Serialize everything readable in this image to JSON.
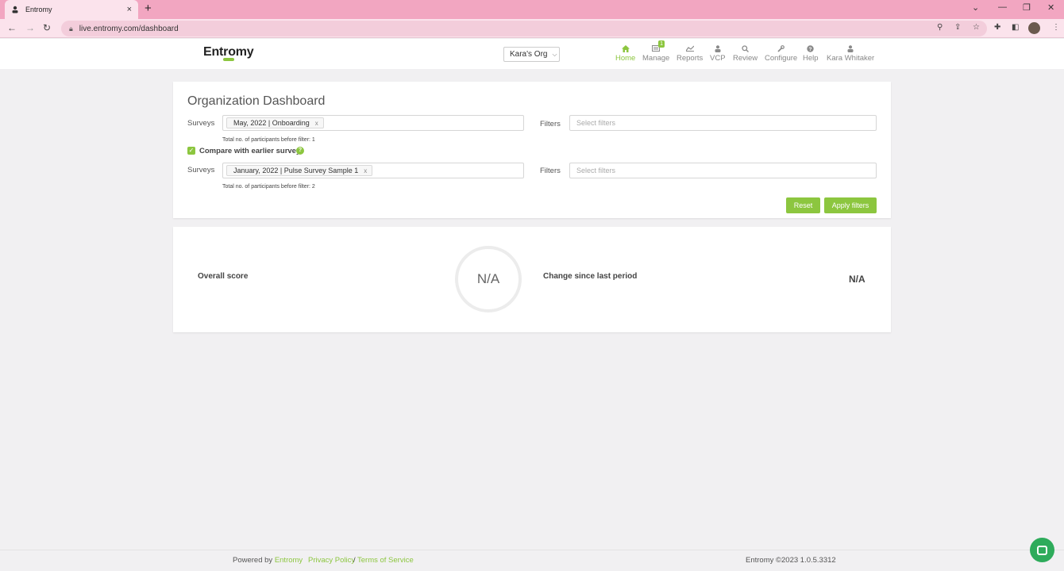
{
  "browser": {
    "tab_title": "Entromy",
    "tab_close": "×",
    "new_tab": "+",
    "url": "live.entromy.com/dashboard"
  },
  "header": {
    "logo": "Entromy",
    "org_select": "Kara's Org",
    "nav": [
      {
        "label": "Home",
        "icon": "home-icon",
        "active": true
      },
      {
        "label": "Manage",
        "icon": "manage-icon",
        "badge": "1"
      },
      {
        "label": "Reports",
        "icon": "chart-icon"
      },
      {
        "label": "VCP",
        "icon": "user-icon"
      },
      {
        "label": "Review",
        "icon": "search-icon"
      },
      {
        "label": "Configure",
        "icon": "wrench-icon"
      },
      {
        "label": "Help",
        "icon": "question-icon"
      },
      {
        "label": "Kara Whitaker",
        "icon": "user-icon"
      }
    ]
  },
  "dashboard": {
    "title": "Organization Dashboard",
    "row1": {
      "surveys_label": "Surveys",
      "survey_chip": "May, 2022 | Onboarding",
      "chip_remove": "x",
      "filters_label": "Filters",
      "filters_placeholder": "Select filters",
      "participants_note": "Total no. of participants before filter: 1"
    },
    "compare_label": "Compare with earlier survey",
    "row2": {
      "surveys_label": "Surveys",
      "survey_chip": "January, 2022 | Pulse Survey Sample 1",
      "chip_remove": "x",
      "filters_label": "Filters",
      "filters_placeholder": "Select filters",
      "participants_note": "Total no. of participants before filter: 2"
    },
    "reset_button": "Reset",
    "apply_button": "Apply filters"
  },
  "scores": {
    "overall_label": "Overall score",
    "overall_value": "N/A",
    "change_label": "Change since last period",
    "change_value": "N/A"
  },
  "footer": {
    "powered_by": "Powered by",
    "brand_link": "Entromy",
    "privacy": "Privacy Policy",
    "separator": "/",
    "terms": "Terms of Service",
    "version": "Entromy ©2023 1.0.5.3312"
  },
  "colors": {
    "accent": "#8cc63f",
    "chrome": "#f2a6c1",
    "chat": "#2eab5b"
  }
}
